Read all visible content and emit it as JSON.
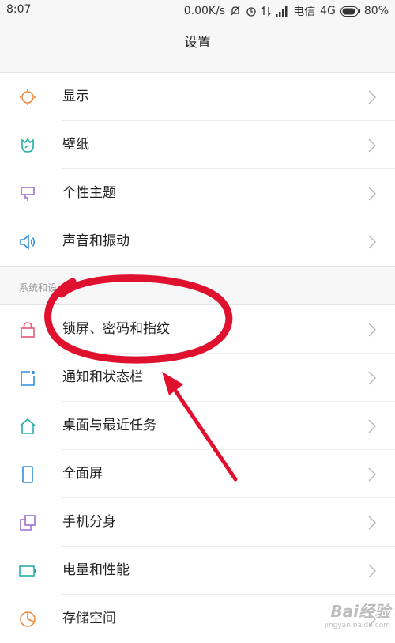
{
  "status_bar": {
    "time": "8:07",
    "network_speed": "0.00K/s",
    "carrier": "电信",
    "network_type": "4G",
    "battery": "80%"
  },
  "header": {
    "title": "设置"
  },
  "section_display": {
    "items": [
      {
        "label": "显示",
        "icon": "sun-icon"
      },
      {
        "label": "壁纸",
        "icon": "tulip-icon"
      },
      {
        "label": "个性主题",
        "icon": "brush-icon"
      },
      {
        "label": "声音和振动",
        "icon": "speaker-icon"
      }
    ]
  },
  "section_system": {
    "header": "系统和设",
    "items": [
      {
        "label": "锁屏、密码和指纹",
        "icon": "lock-icon"
      },
      {
        "label": "通知和状态栏",
        "icon": "notification-icon"
      },
      {
        "label": "桌面与最近任务",
        "icon": "home-icon"
      },
      {
        "label": "全面屏",
        "icon": "phone-icon"
      },
      {
        "label": "手机分身",
        "icon": "clone-icon"
      },
      {
        "label": "电量和性能",
        "icon": "battery-icon"
      },
      {
        "label": "存储空间",
        "icon": "pie-icon"
      }
    ]
  },
  "watermark": {
    "brand": "Bai经验",
    "url": "jingyan.baidu.com"
  },
  "colors": {
    "annotation_red": "#e0102f",
    "orange": "#f08a3c",
    "teal": "#25b0a6",
    "purple": "#9b6fd6",
    "blue": "#2f8fe0",
    "pink": "#e8567a"
  }
}
